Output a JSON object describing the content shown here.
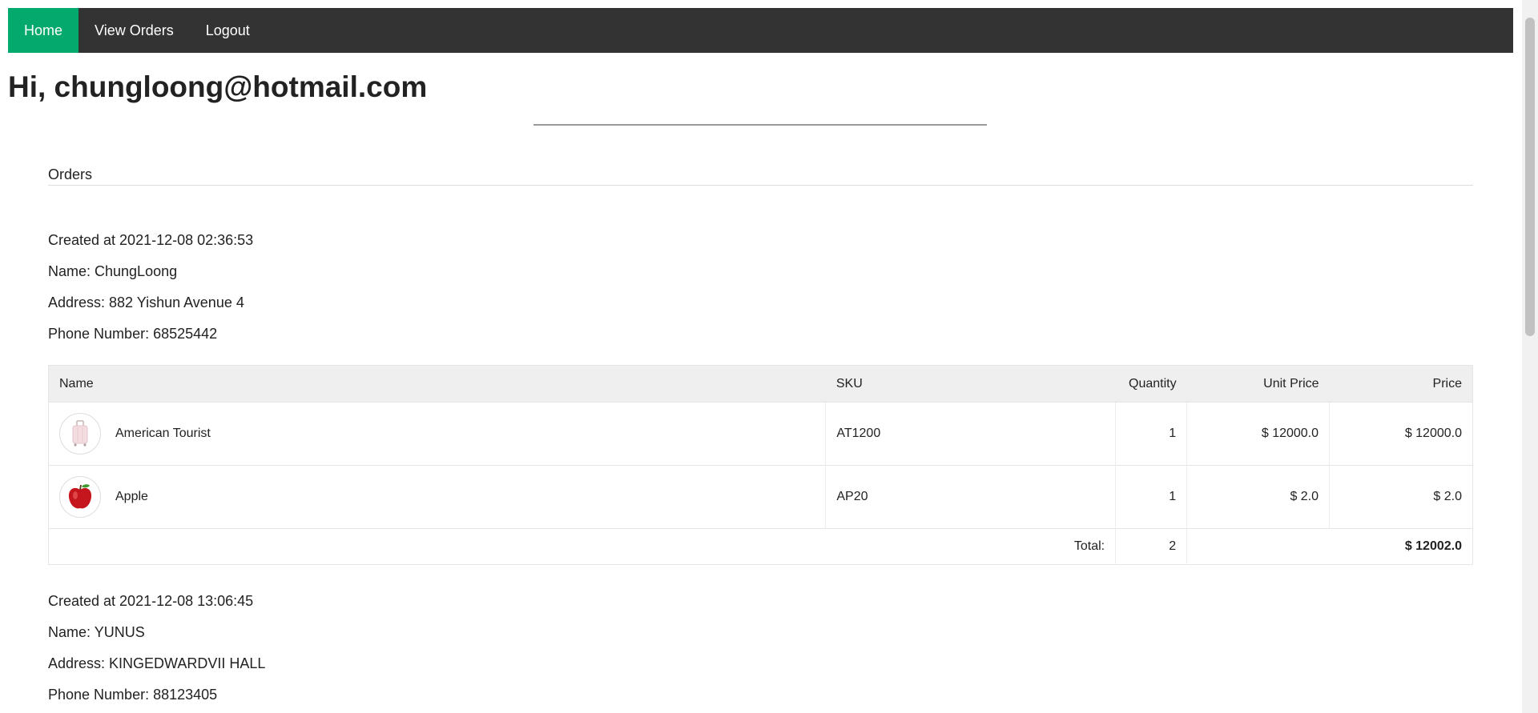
{
  "nav": {
    "items": [
      {
        "label": "Home"
      },
      {
        "label": "View Orders"
      },
      {
        "label": "Logout"
      }
    ]
  },
  "greeting": "Hi, chungloong@hotmail.com",
  "section_title": "Orders",
  "table_headers": {
    "name": "Name",
    "sku": "SKU",
    "quantity": "Quantity",
    "unit_price": "Unit Price",
    "price": "Price"
  },
  "orders": [
    {
      "created": "Created at 2021-12-08 02:36:53",
      "name": "Name: ChungLoong",
      "address": "Address: 882 Yishun Avenue 4",
      "phone": "Phone Number: 68525442",
      "items": [
        {
          "icon": "luggage-icon",
          "name": "American Tourist",
          "sku": "AT1200",
          "quantity": "1",
          "unit_price": "$ 12000.0",
          "price": "$ 12000.0"
        },
        {
          "icon": "apple-icon",
          "name": "Apple",
          "sku": "AP20",
          "quantity": "1",
          "unit_price": "$ 2.0",
          "price": "$ 2.0"
        }
      ],
      "total_label": "Total:",
      "total_quantity": "2",
      "total_price": "$ 12002.0"
    },
    {
      "created": "Created at 2021-12-08 13:06:45",
      "name": "Name: YUNUS",
      "address": "Address: KINGEDWARDVII HALL",
      "phone": "Phone Number: 88123405"
    }
  ],
  "colors": {
    "nav_bg": "#333333",
    "nav_active": "#04AA6D",
    "table_header_bg": "#efefef"
  }
}
